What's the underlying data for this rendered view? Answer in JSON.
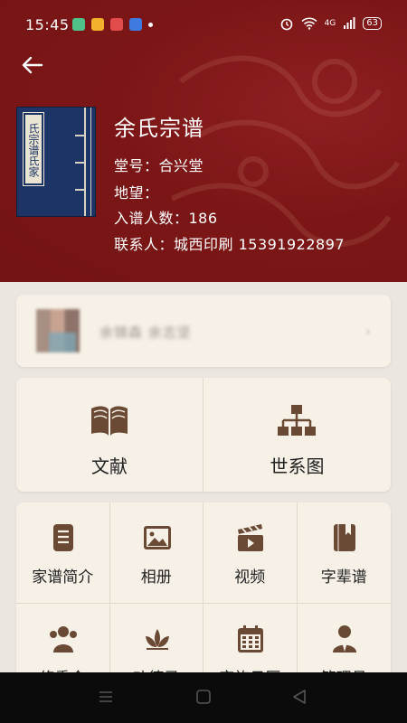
{
  "status_bar": {
    "time": "15:45",
    "battery": "63",
    "network": "4G"
  },
  "header": {
    "book_label": "氏宗谱氏家",
    "title": "余氏宗谱",
    "hall": "堂号：合兴堂",
    "location": "地望：",
    "members": "入谱人数：186",
    "contact": "联系人：城西印刷    15391922897"
  },
  "user_card": {
    "name": "余锦森 余志坚",
    "chevron": "›"
  },
  "big_tiles": [
    {
      "label": "文献",
      "icon": "book-open-icon"
    },
    {
      "label": "世系图",
      "icon": "sitemap-icon"
    }
  ],
  "grid_items": [
    {
      "label": "家谱简介",
      "icon": "document-list-icon"
    },
    {
      "label": "相册",
      "icon": "photo-icon"
    },
    {
      "label": "视频",
      "icon": "video-clapper-icon"
    },
    {
      "label": "字辈谱",
      "icon": "book-bookmark-icon"
    },
    {
      "label": "修委会",
      "icon": "people-group-icon"
    },
    {
      "label": "功德录",
      "icon": "lotus-icon"
    },
    {
      "label": "宗族日历",
      "icon": "calendar-icon"
    },
    {
      "label": "管理员",
      "icon": "admin-user-icon"
    }
  ],
  "colors": {
    "header": "#7c1616",
    "icon": "#6b4a35",
    "card": "#f6f0e6"
  }
}
